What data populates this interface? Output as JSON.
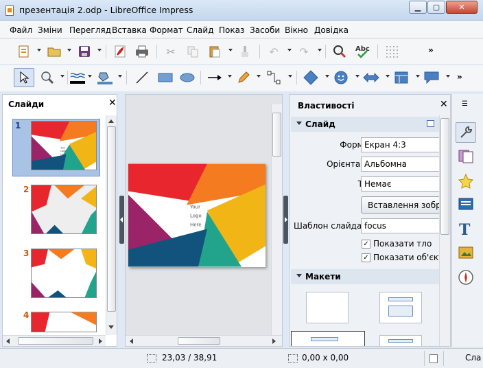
{
  "window": {
    "title": "презентація 2.odp - LibreOffice Impress"
  },
  "menu": [
    "Файл",
    "Зміни",
    "Перегляд",
    "Вставка",
    "Формат",
    "Слайд",
    "Показ",
    "Засоби",
    "Вікно",
    "Довідка"
  ],
  "slides_pane": {
    "title": "Слайди",
    "numbers": [
      "1",
      "2",
      "3",
      "4"
    ]
  },
  "slide": {
    "logo_lines": [
      "Your",
      "Logo",
      "Here"
    ]
  },
  "properties": {
    "title": "Властивості",
    "section_slide": "Слайд",
    "format_label": "Формат:",
    "format_value": "Екран 4:3",
    "orientation_label": "Орієнтація:",
    "orientation_value": "Альбомна",
    "background_label": "Тло:",
    "background_value": "Немає",
    "insert_image_button": "Вставлення зобра",
    "template_label": "Шаблон слайда:",
    "template_value": "focus",
    "show_background": "Показати тло",
    "show_objects": "Показати об'єкти",
    "section_layouts": "Макети"
  },
  "status": {
    "position": "23,03 / 38,91",
    "size": "0,00 x 0,00",
    "right": "Сла"
  },
  "colors": {
    "red": "#e8262e",
    "orange": "#f47b20",
    "yellow": "#f2b516",
    "teal": "#22a38b",
    "purple": "#9b2468",
    "navy": "#11537d"
  }
}
